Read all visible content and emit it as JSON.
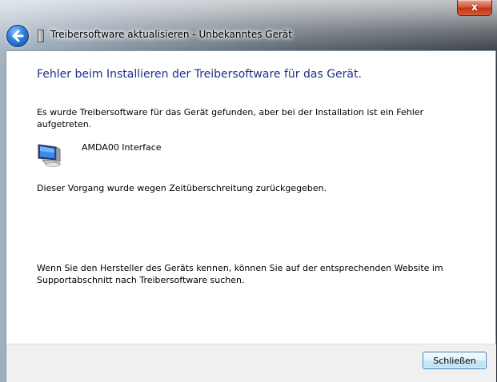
{
  "window": {
    "title": "Treibersoftware aktualisieren - Unbekanntes Gerät",
    "close_glyph": "x"
  },
  "dialog": {
    "heading": "Fehler beim Installieren der Treibersoftware für das Gerät.",
    "message": "Es wurde Treibersoftware für das Gerät gefunden, aber bei der Installation ist ein Fehler aufgetreten.",
    "device_name": "AMDA00 Interface",
    "error_reason": "Dieser Vorgang wurde wegen Zeitüberschreitung zurückgegeben.",
    "hint": "Wenn Sie den Hersteller des Geräts kennen, können Sie auf der entsprechenden Website im Supportabschnitt nach Treibersoftware suchen."
  },
  "footer": {
    "close_label": "Schließen"
  },
  "icons": {
    "back": "back-arrow-icon",
    "device": "monitor-device-icon"
  },
  "colors": {
    "heading": "#1e3287",
    "close_red": "#c2341a"
  }
}
